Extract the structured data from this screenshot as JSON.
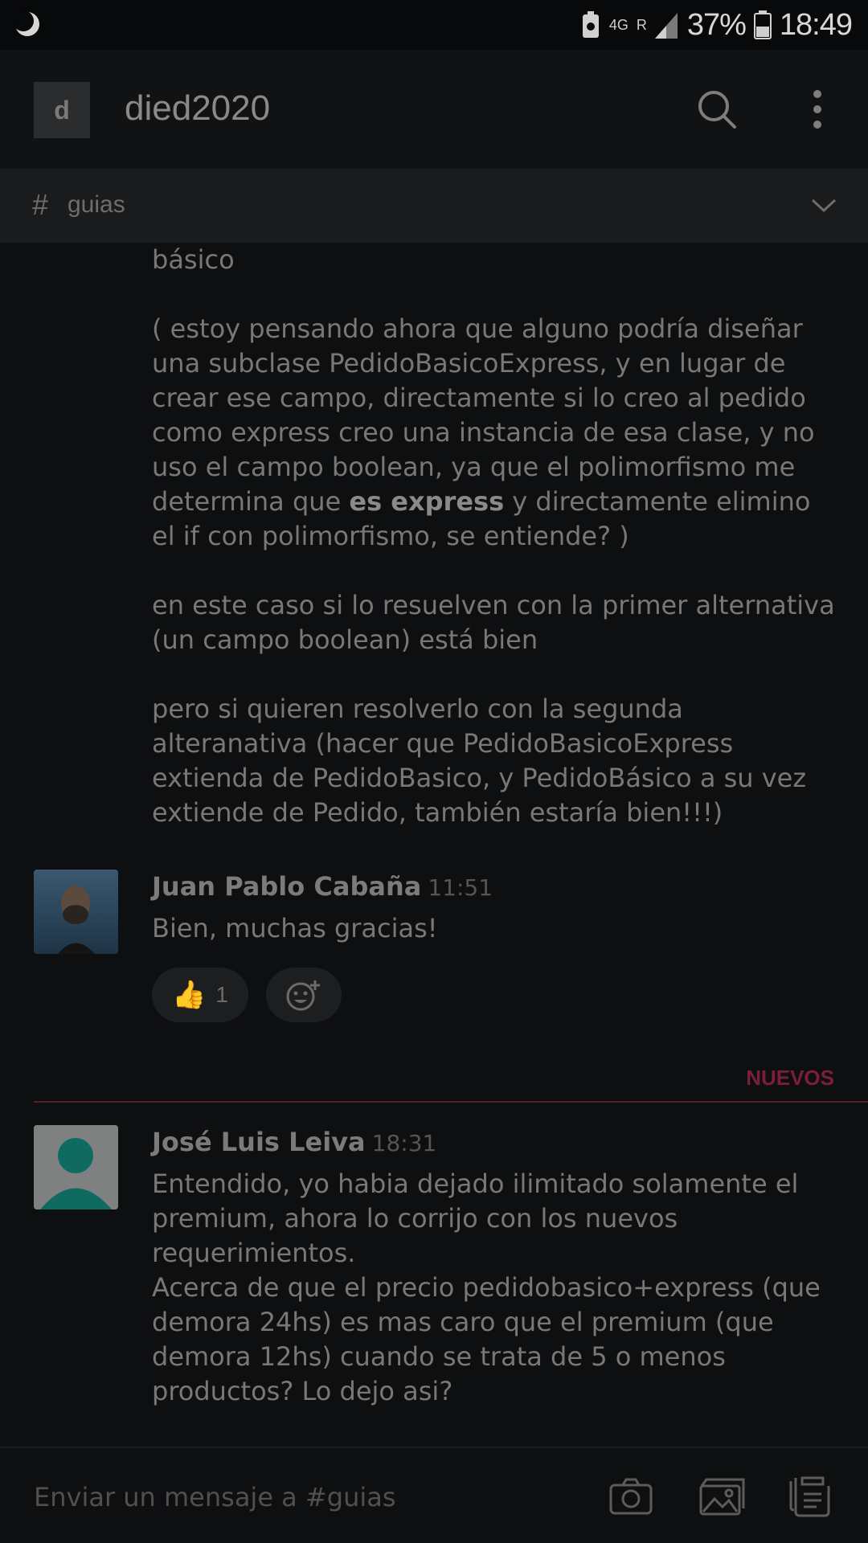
{
  "status_bar": {
    "network": "4G",
    "roaming": "R",
    "battery": "37%",
    "time": "18:49"
  },
  "header": {
    "workspace_initial": "d",
    "workspace_name": "died2020"
  },
  "channel": {
    "hash": "#",
    "name": "guias"
  },
  "continued_message": {
    "line_top": "básico",
    "para1_a": "( estoy pensando ahora que alguno podría diseñar una subclase PedidoBasicoExpress, y en lugar de crear ese campo, directamente si lo creo al pedido como express creo una instancia de esa clase, y no uso el campo boolean, ya que el polimorfismo me determina que ",
    "para1_bold": "es express",
    "para1_b": " y directamente elimino el if con polimorfismo, se entiende? )",
    "para2": "en este caso si lo resuelven con la primer alternativa (un campo boolean) está bien",
    "para3": "pero si quieren resolverlo con la segunda alteranativa (hacer que PedidoBasicoExpress extienda de PedidoBasico, y PedidoBásico a su vez extiende de Pedido, también estaría bien!!!)"
  },
  "messages": [
    {
      "author": "Juan Pablo Cabaña",
      "time": "11:51",
      "text": "Bien, muchas gracias!",
      "reaction": {
        "emoji": "👍",
        "count": "1"
      }
    },
    {
      "author": "José Luis Leiva",
      "time": "18:31",
      "text_1": "Entendido, yo habia dejado ilimitado solamente el premium, ahora lo corrijo con los nuevos requerimientos.",
      "text_2": "Acerca de que el precio pedidobasico+express (que demora 24hs) es mas caro que el premium (que demora 12hs) cuando se trata de 5 o menos productos? Lo dejo asi?"
    }
  ],
  "new_divider_label": "NUEVOS",
  "composer": {
    "placeholder": "Enviar un mensaje a #guias"
  },
  "icons": {
    "search": "search-icon",
    "more": "more-vertical-icon",
    "chevron": "chevron-down-icon",
    "camera": "camera-icon",
    "gallery": "gallery-icon",
    "files": "files-icon",
    "add_reaction": "add-reaction-icon"
  },
  "colors": {
    "background": "#0e0f11",
    "new_divider": "#7a1f37",
    "avatar_teal": "#0f6b60"
  }
}
